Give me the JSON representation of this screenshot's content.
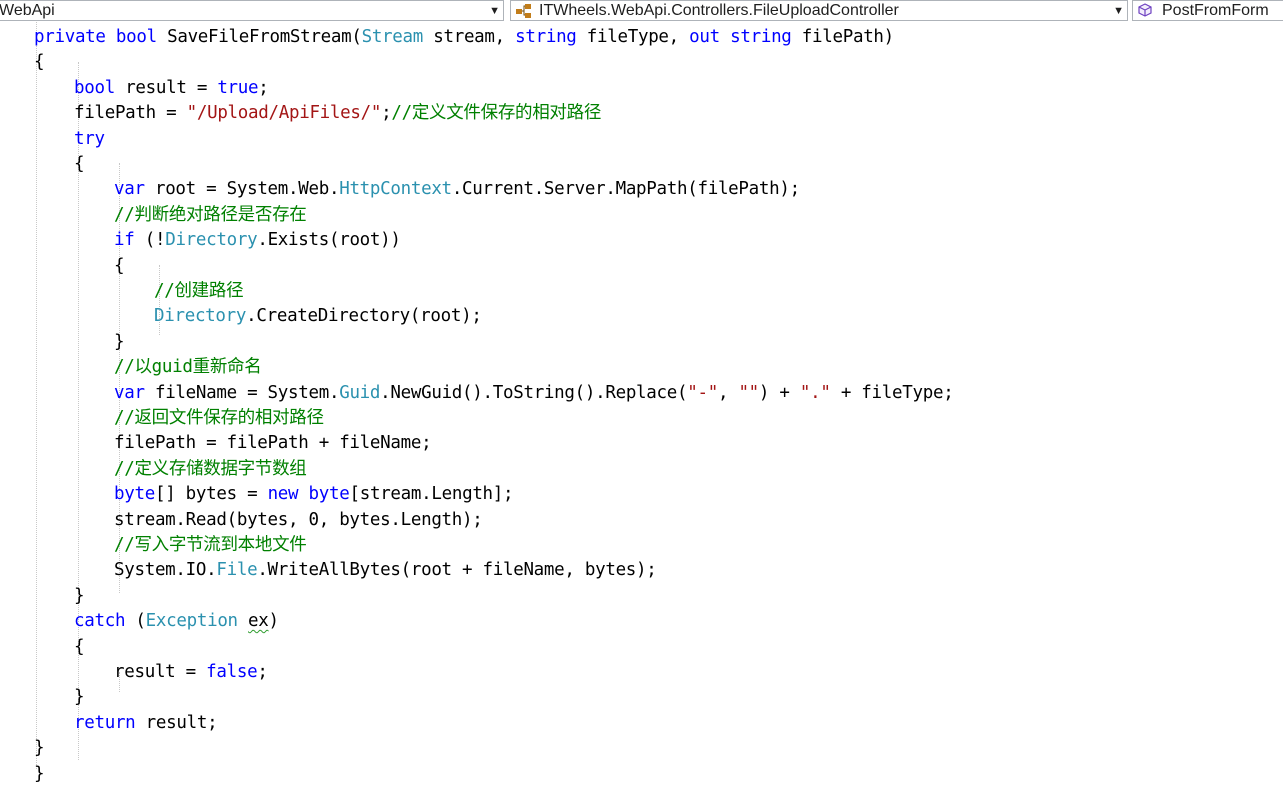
{
  "navbar": {
    "project": "WebApi",
    "type": "ITWheels.WebApi.Controllers.FileUploadController",
    "member": "PostFromForm"
  },
  "code": {
    "lines": [
      {
        "indent": 1,
        "tokens": [
          [
            "kw",
            "private"
          ],
          [
            "pl",
            " "
          ],
          [
            "kw",
            "bool"
          ],
          [
            "pl",
            " SaveFileFromStream("
          ],
          [
            "ty",
            "Stream"
          ],
          [
            "pl",
            " stream, "
          ],
          [
            "kw",
            "string"
          ],
          [
            "pl",
            " fileType, "
          ],
          [
            "kw",
            "out"
          ],
          [
            "pl",
            " "
          ],
          [
            "kw",
            "string"
          ],
          [
            "pl",
            " filePath)"
          ]
        ]
      },
      {
        "indent": 1,
        "tokens": [
          [
            "pl",
            "{"
          ]
        ]
      },
      {
        "indent": 2,
        "tokens": [
          [
            "kw",
            "bool"
          ],
          [
            "pl",
            " result = "
          ],
          [
            "kw",
            "true"
          ],
          [
            "pl",
            ";"
          ]
        ]
      },
      {
        "indent": 2,
        "tokens": [
          [
            "pl",
            "filePath = "
          ],
          [
            "st",
            "\"/Upload/ApiFiles/\""
          ],
          [
            "pl",
            ";"
          ],
          [
            "cm",
            "//定义文件保存的相对路径"
          ]
        ]
      },
      {
        "indent": 2,
        "tokens": [
          [
            "kw",
            "try"
          ]
        ]
      },
      {
        "indent": 2,
        "tokens": [
          [
            "pl",
            "{"
          ]
        ]
      },
      {
        "indent": 3,
        "tokens": [
          [
            "kw",
            "var"
          ],
          [
            "pl",
            " root = System.Web."
          ],
          [
            "ty",
            "HttpContext"
          ],
          [
            "pl",
            ".Current.Server.MapPath(filePath);"
          ]
        ]
      },
      {
        "indent": 3,
        "tokens": [
          [
            "cm",
            "//判断绝对路径是否存在"
          ]
        ]
      },
      {
        "indent": 3,
        "tokens": [
          [
            "kw",
            "if"
          ],
          [
            "pl",
            " (!"
          ],
          [
            "ty",
            "Directory"
          ],
          [
            "pl",
            ".Exists(root))"
          ]
        ]
      },
      {
        "indent": 3,
        "tokens": [
          [
            "pl",
            "{"
          ]
        ]
      },
      {
        "indent": 4,
        "tokens": [
          [
            "cm",
            "//创建路径"
          ]
        ]
      },
      {
        "indent": 4,
        "tokens": [
          [
            "ty",
            "Directory"
          ],
          [
            "pl",
            ".CreateDirectory(root);"
          ]
        ]
      },
      {
        "indent": 3,
        "tokens": [
          [
            "pl",
            "}"
          ]
        ]
      },
      {
        "indent": 3,
        "tokens": [
          [
            "cm",
            "//以guid重新命名"
          ]
        ]
      },
      {
        "indent": 3,
        "tokens": [
          [
            "kw",
            "var"
          ],
          [
            "pl",
            " fileName = System."
          ],
          [
            "ty",
            "Guid"
          ],
          [
            "pl",
            ".NewGuid().ToString().Replace("
          ],
          [
            "st",
            "\"-\""
          ],
          [
            "pl",
            ", "
          ],
          [
            "st",
            "\"\""
          ],
          [
            "pl",
            ") + "
          ],
          [
            "st",
            "\".\""
          ],
          [
            "pl",
            " + fileType;"
          ]
        ]
      },
      {
        "indent": 3,
        "tokens": [
          [
            "cm",
            "//返回文件保存的相对路径"
          ]
        ]
      },
      {
        "indent": 3,
        "tokens": [
          [
            "pl",
            "filePath = filePath + fileName;"
          ]
        ]
      },
      {
        "indent": 3,
        "tokens": [
          [
            "cm",
            "//定义存储数据字节数组"
          ]
        ]
      },
      {
        "indent": 3,
        "tokens": [
          [
            "kw",
            "byte"
          ],
          [
            "pl",
            "[] bytes = "
          ],
          [
            "kw",
            "new"
          ],
          [
            "pl",
            " "
          ],
          [
            "kw",
            "byte"
          ],
          [
            "pl",
            "[stream.Length];"
          ]
        ]
      },
      {
        "indent": 3,
        "tokens": [
          [
            "pl",
            "stream.Read(bytes, 0, bytes.Length);"
          ]
        ]
      },
      {
        "indent": 3,
        "tokens": [
          [
            "cm",
            "//写入字节流到本地文件"
          ]
        ]
      },
      {
        "indent": 3,
        "tokens": [
          [
            "pl",
            "System.IO."
          ],
          [
            "ty",
            "File"
          ],
          [
            "pl",
            ".WriteAllBytes(root + fileName, bytes);"
          ]
        ]
      },
      {
        "indent": 2,
        "tokens": [
          [
            "pl",
            "}"
          ]
        ]
      },
      {
        "indent": 2,
        "tokens": [
          [
            "kw",
            "catch"
          ],
          [
            "pl",
            " ("
          ],
          [
            "ty",
            "Exception"
          ],
          [
            "pl",
            " "
          ],
          [
            "sq",
            "ex"
          ],
          [
            "pl",
            ")"
          ]
        ]
      },
      {
        "indent": 2,
        "tokens": [
          [
            "pl",
            "{"
          ]
        ]
      },
      {
        "indent": 3,
        "tokens": [
          [
            "pl",
            "result = "
          ],
          [
            "kw",
            "false"
          ],
          [
            "pl",
            ";"
          ]
        ]
      },
      {
        "indent": 2,
        "tokens": [
          [
            "pl",
            "}"
          ]
        ]
      },
      {
        "indent": 2,
        "tokens": [
          [
            "kw",
            "return"
          ],
          [
            "pl",
            " result;"
          ]
        ]
      },
      {
        "indent": 1,
        "tokens": [
          [
            "pl",
            "}"
          ]
        ]
      },
      {
        "indent": 0,
        "tokens": [
          [
            "pl",
            "}"
          ]
        ]
      }
    ]
  },
  "colors": {
    "keyword": "#0000ff",
    "type": "#2b91af",
    "string": "#a31515",
    "comment": "#008000"
  }
}
